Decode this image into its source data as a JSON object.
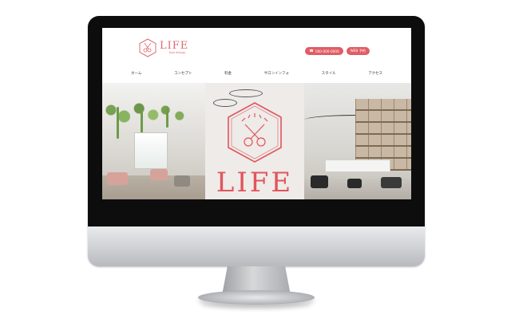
{
  "site": {
    "logo": {
      "icon": "scissors-hexagon-icon",
      "name": "LIFE",
      "tagline": "hair design"
    },
    "header_buttons": {
      "phone": {
        "icon": "phone-icon",
        "label": "000-000-0000"
      },
      "reserve": {
        "icon": "calendar-icon",
        "label": "WEB 予約"
      }
    },
    "nav": [
      "ホーム",
      "コンセプト",
      "料金",
      "サロンインフォ",
      "スタイル",
      "アクセス"
    ],
    "hero": {
      "panels": [
        "salon-interior-left",
        "logo-overlay-center",
        "salon-interior-right"
      ],
      "center_text": "LIFE",
      "center_icon": "scissors-hexagon-icon"
    }
  },
  "colors": {
    "accent": "#e05d65",
    "text": "#333333",
    "monitor_bezel": "#0d0d0e",
    "monitor_body": "#d6d7d9"
  }
}
